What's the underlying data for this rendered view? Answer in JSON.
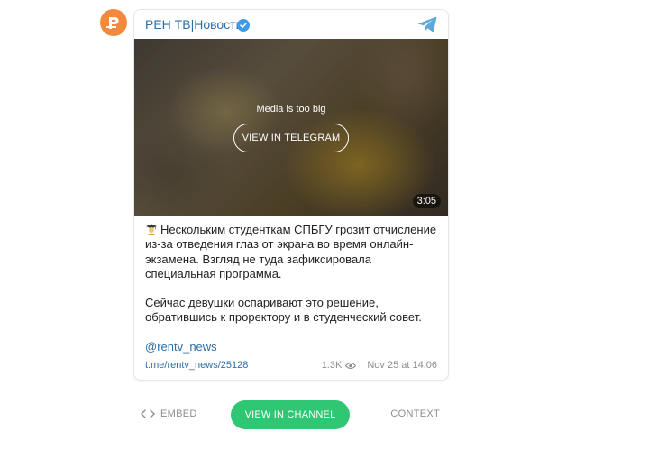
{
  "header": {
    "channel_name": "РЕН ТВ|Новости",
    "verified_icon": "verified-badge-icon",
    "telegram_icon": "telegram-logo-icon"
  },
  "media": {
    "notice": "Media is too big",
    "view_button": "VIEW IN TELEGRAM",
    "duration": "3:05"
  },
  "post": {
    "emoji_icon": "student-emoji-icon",
    "paragraph_1": "Нескольким студенткам СПБГУ грозит отчисление из-за отведения глаз от экрана во время онлайн-экзамена. Взгляд не туда зафиксировала специальная программа.",
    "paragraph_2": "Сейчас девушки оспаривают это решение, обратившись к проректору и в студенческий совет.",
    "mention": "@rentv_news",
    "link": "t.me/rentv_news/25128",
    "views": "1.3K",
    "date": "Nov 25 at 14:06"
  },
  "actions": {
    "embed": "EMBED",
    "view_channel": "VIEW IN CHANNEL",
    "context": "CONTEXT"
  },
  "colors": {
    "accent_blue": "#2f6ea5",
    "button_green": "#2fc774",
    "avatar_orange": "#f28a3e",
    "muted_gray": "#8b8e92"
  }
}
